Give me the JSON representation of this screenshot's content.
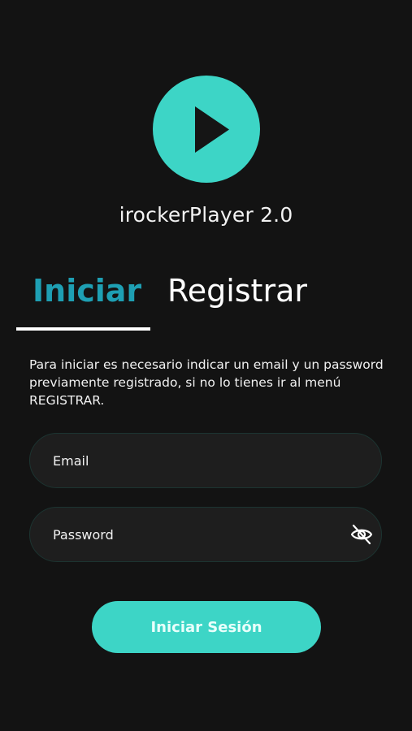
{
  "app": {
    "title": "irockerPlayer 2.0"
  },
  "logo": {
    "icon": "play-icon",
    "color": "#3dd5c6"
  },
  "tabs": [
    {
      "label": "Iniciar",
      "active": true
    },
    {
      "label": "Registrar",
      "active": false
    }
  ],
  "description": "Para iniciar es necesario indicar  un email y  un password previamente registrado, si no lo tienes ir al menú  REGISTRAR.",
  "form": {
    "email": {
      "placeholder": "Email",
      "value": ""
    },
    "password": {
      "placeholder": "Password",
      "value": "",
      "toggle_icon": "eye-off-icon"
    },
    "submit_label": "Iniciar Sesión"
  },
  "colors": {
    "accent": "#3dd5c6",
    "active_tab": "#1e9fb3",
    "background": "#131313",
    "field_background": "#1e1e1e"
  }
}
